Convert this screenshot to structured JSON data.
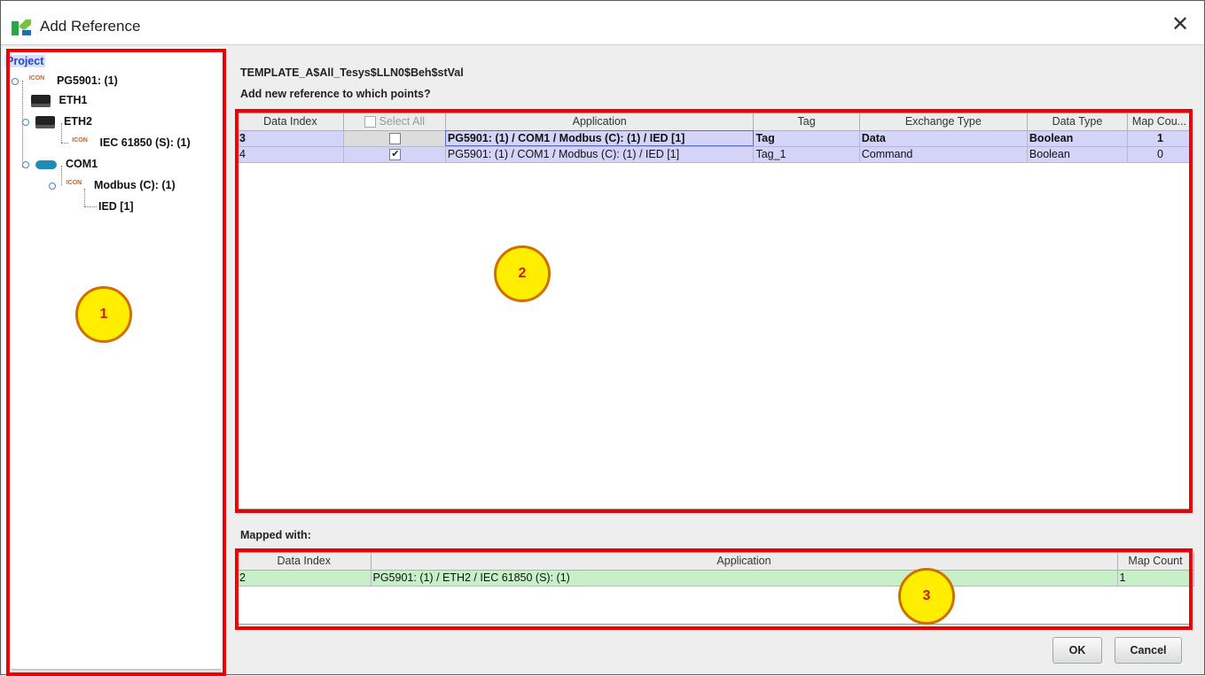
{
  "window": {
    "title": "Add Reference",
    "close_symbol": "✕"
  },
  "tree": {
    "root": "Project",
    "items": [
      {
        "label": "PG5901: (1)",
        "icon": "pg-icon",
        "pg_text": "ICON"
      },
      {
        "label": "ETH1",
        "icon": "ethernet-icon"
      },
      {
        "label": "ETH2",
        "icon": "ethernet-icon"
      },
      {
        "label": "IEC 61850 (S): (1)",
        "icon": "pg-icon",
        "pg_text": "ICON"
      },
      {
        "label": "COM1",
        "icon": "serial-port-icon"
      },
      {
        "label": "Modbus (C): (1)",
        "icon": "pg-icon",
        "pg_text": "ICON"
      },
      {
        "label": "IED [1]"
      }
    ]
  },
  "reference": {
    "name": "TEMPLATE_A$All_Tesys$LLN0$Beh$stVal",
    "prompt": "Add new reference to which points?"
  },
  "points_table": {
    "columns": [
      "Data Index",
      "Select All",
      "Application",
      "Tag",
      "Exchange Type",
      "Data Type",
      "Map Cou..."
    ],
    "rows": [
      {
        "data_index": "3",
        "checked": false,
        "application": "PG5901: (1) / COM1 / Modbus (C): (1) / IED [1]",
        "tag": "Tag",
        "exchange_type": "Data",
        "data_type": "Boolean",
        "map_count": "1"
      },
      {
        "data_index": "4",
        "checked": true,
        "application": "PG5901: (1) / COM1 / Modbus (C): (1) / IED [1]",
        "tag": "Tag_1",
        "exchange_type": "Command",
        "data_type": "Boolean",
        "map_count": "0"
      }
    ]
  },
  "mapped": {
    "label": "Mapped with:",
    "columns": [
      "Data Index",
      "Application",
      "Map Count"
    ],
    "rows": [
      {
        "data_index": "2",
        "application": "PG5901: (1) / ETH2 / IEC 61850 (S): (1)",
        "map_count": "1"
      }
    ]
  },
  "buttons": {
    "ok": "OK",
    "cancel": "Cancel"
  },
  "annotations": {
    "marker1": "1",
    "marker2": "2",
    "marker3": "3",
    "highlight_color": "#ee0000",
    "marker_color": "#ffee00"
  }
}
